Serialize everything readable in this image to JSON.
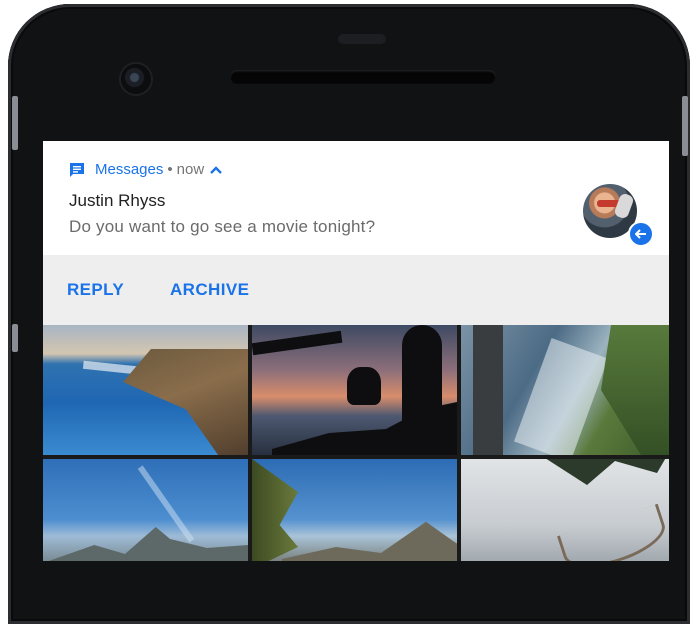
{
  "notification": {
    "app_name": "Messages",
    "separator": "•",
    "time": "now",
    "expand_icon": "chevron-up-icon",
    "app_icon": "messages-icon",
    "sender": "Justin Rhyss",
    "message": "Do you want to go see a movie tonight?",
    "avatar_badge_icon": "reply-arrow-icon",
    "accent_color": "#1a73e8"
  },
  "actions": {
    "reply_label": "REPLY",
    "archive_label": "ARCHIVE"
  },
  "photos": [
    {
      "subject": "coastal-cliffs-photo"
    },
    {
      "subject": "sunset-silhouette-photo"
    },
    {
      "subject": "aerial-coast-photo"
    },
    {
      "subject": "half-dome-photo"
    },
    {
      "subject": "valley-mountains-photo"
    },
    {
      "subject": "hammock-palm-photo"
    }
  ]
}
